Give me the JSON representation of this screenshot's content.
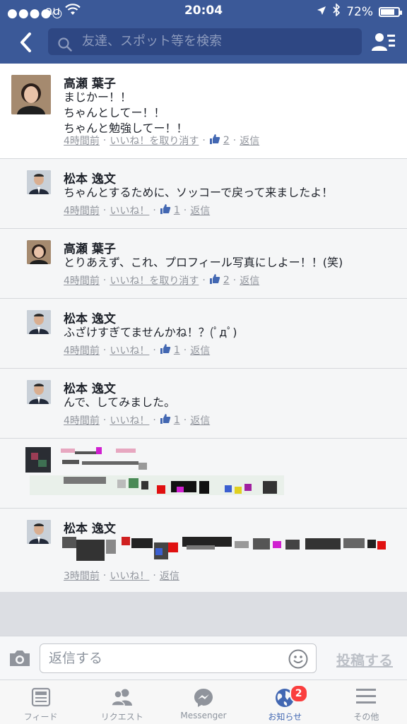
{
  "status_bar": {
    "signal": "●●●●○",
    "carrier": "au",
    "time": "20:04",
    "battery": "72%"
  },
  "header": {
    "search_placeholder": "友達、スポット等を検索"
  },
  "comments": [
    {
      "name": "高瀬 葉子",
      "lines": [
        "まじかー！！",
        "ちゃんとしてー！！",
        "ちゃんと勉強してー！！"
      ],
      "time": "4時間前",
      "like_action": "いいね！を取り消す",
      "like_count": "2",
      "reply": "返信"
    },
    {
      "name": "松本 逸文",
      "lines": [
        "ちゃんとするために、ソッコーで戻って来ましたよ！"
      ],
      "time": "4時間前",
      "like_action": "いいね！",
      "like_count": "1",
      "reply": "返信"
    },
    {
      "name": "高瀬 葉子",
      "lines": [
        "とりあえず、これ、プロフィール写真にしよー！！(笑)"
      ],
      "time": "4時間前",
      "like_action": "いいね！を取り消す",
      "like_count": "2",
      "reply": "返信"
    },
    {
      "name": "松本 逸文",
      "lines": [
        "ふざけすぎてませんかね！？(ﾟдﾟ)"
      ],
      "time": "4時間前",
      "like_action": "いいね！",
      "like_count": "1",
      "reply": "返信"
    },
    {
      "name": "松本 逸文",
      "lines": [
        "んで、してみました。"
      ],
      "time": "4時間前",
      "like_action": "いいね！",
      "like_count": "1",
      "reply": "返信"
    },
    {
      "name": "松本 逸文",
      "time": "3時間前",
      "like_action": "いいね！",
      "reply": "返信"
    }
  ],
  "reply_bar": {
    "placeholder": "返信する",
    "post_label": "投稿する"
  },
  "tabs": [
    {
      "label": "フィード",
      "icon": "feed-icon"
    },
    {
      "label": "リクエスト",
      "icon": "friend-requests-icon"
    },
    {
      "label": "Messenger",
      "icon": "messenger-icon"
    },
    {
      "label": "お知らせ",
      "icon": "globe-icon",
      "badge": "2"
    },
    {
      "label": "その他",
      "icon": "menu-icon"
    }
  ],
  "colors": {
    "brand": "#3b5998",
    "badge": "#fa3e3e",
    "active_tab": "#4267b2"
  }
}
